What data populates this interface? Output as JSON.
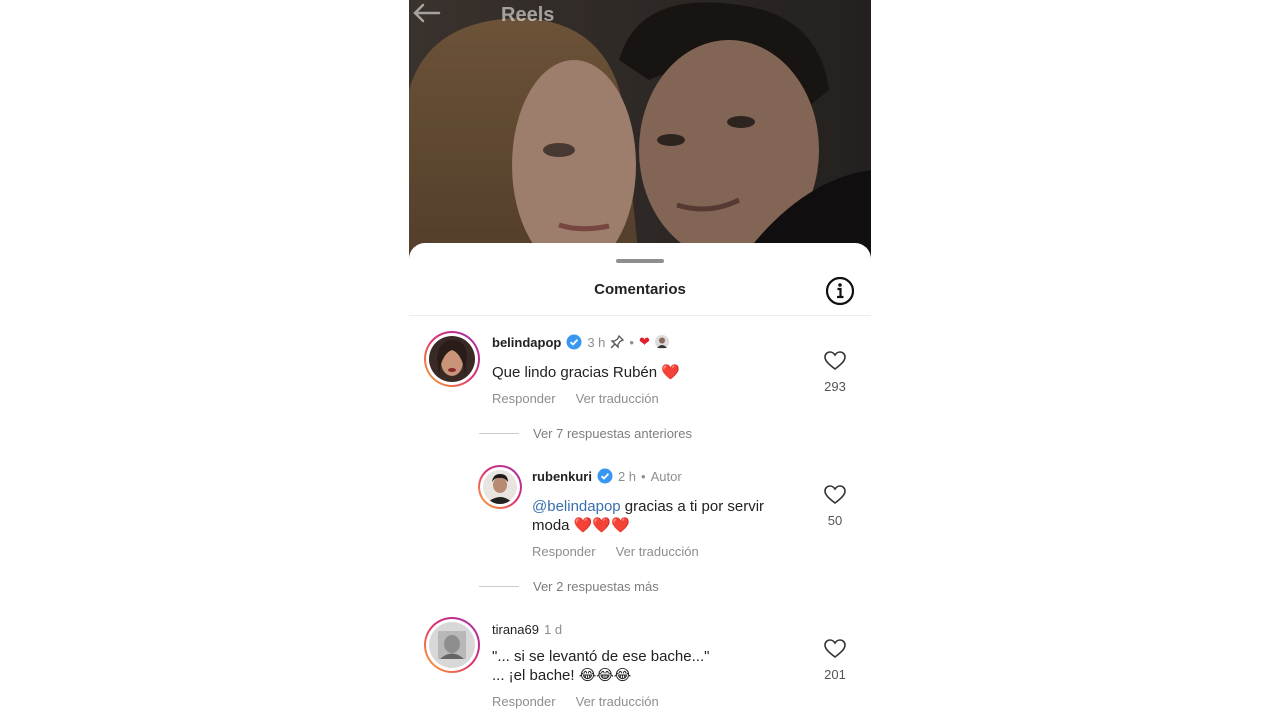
{
  "header": {
    "title": "Reels",
    "back_icon": "arrow-left-icon"
  },
  "sheet": {
    "title": "Comentarios",
    "info_icon": "info-icon"
  },
  "comments": [
    {
      "username": "belindapop",
      "verified": true,
      "time": "3 h",
      "pinned": true,
      "text": "Que lindo gracias Rubén ❤️",
      "actions": {
        "reply": "Responder",
        "translate": "Ver traducción"
      },
      "likes": "293"
    }
  ],
  "thread_more_before": "Ver 7 respuestas anteriores",
  "reply": {
    "username": "rubenkuri",
    "verified": true,
    "time": "2 h",
    "author_tag": "Autor",
    "mention": "@belindapop",
    "text_line1": " gracias a ti por servir",
    "text_line2": "moda ❤️❤️❤️",
    "actions": {
      "reply": "Responder",
      "translate": "Ver traducción"
    },
    "likes": "50"
  },
  "thread_more_after": "Ver 2 respuestas más",
  "comment2": {
    "username": "tirana69",
    "time": "1 d",
    "text_line1": "\"... si se levantó de ese bache...\"",
    "text_line2": "... ¡el bache! 😂😂😂",
    "actions": {
      "reply": "Responder",
      "translate": "Ver traducción"
    },
    "likes": "201"
  },
  "colors": {
    "accent_blue": "#3897f0",
    "heart_red": "#e0202e",
    "muted": "#8e8e8e"
  }
}
